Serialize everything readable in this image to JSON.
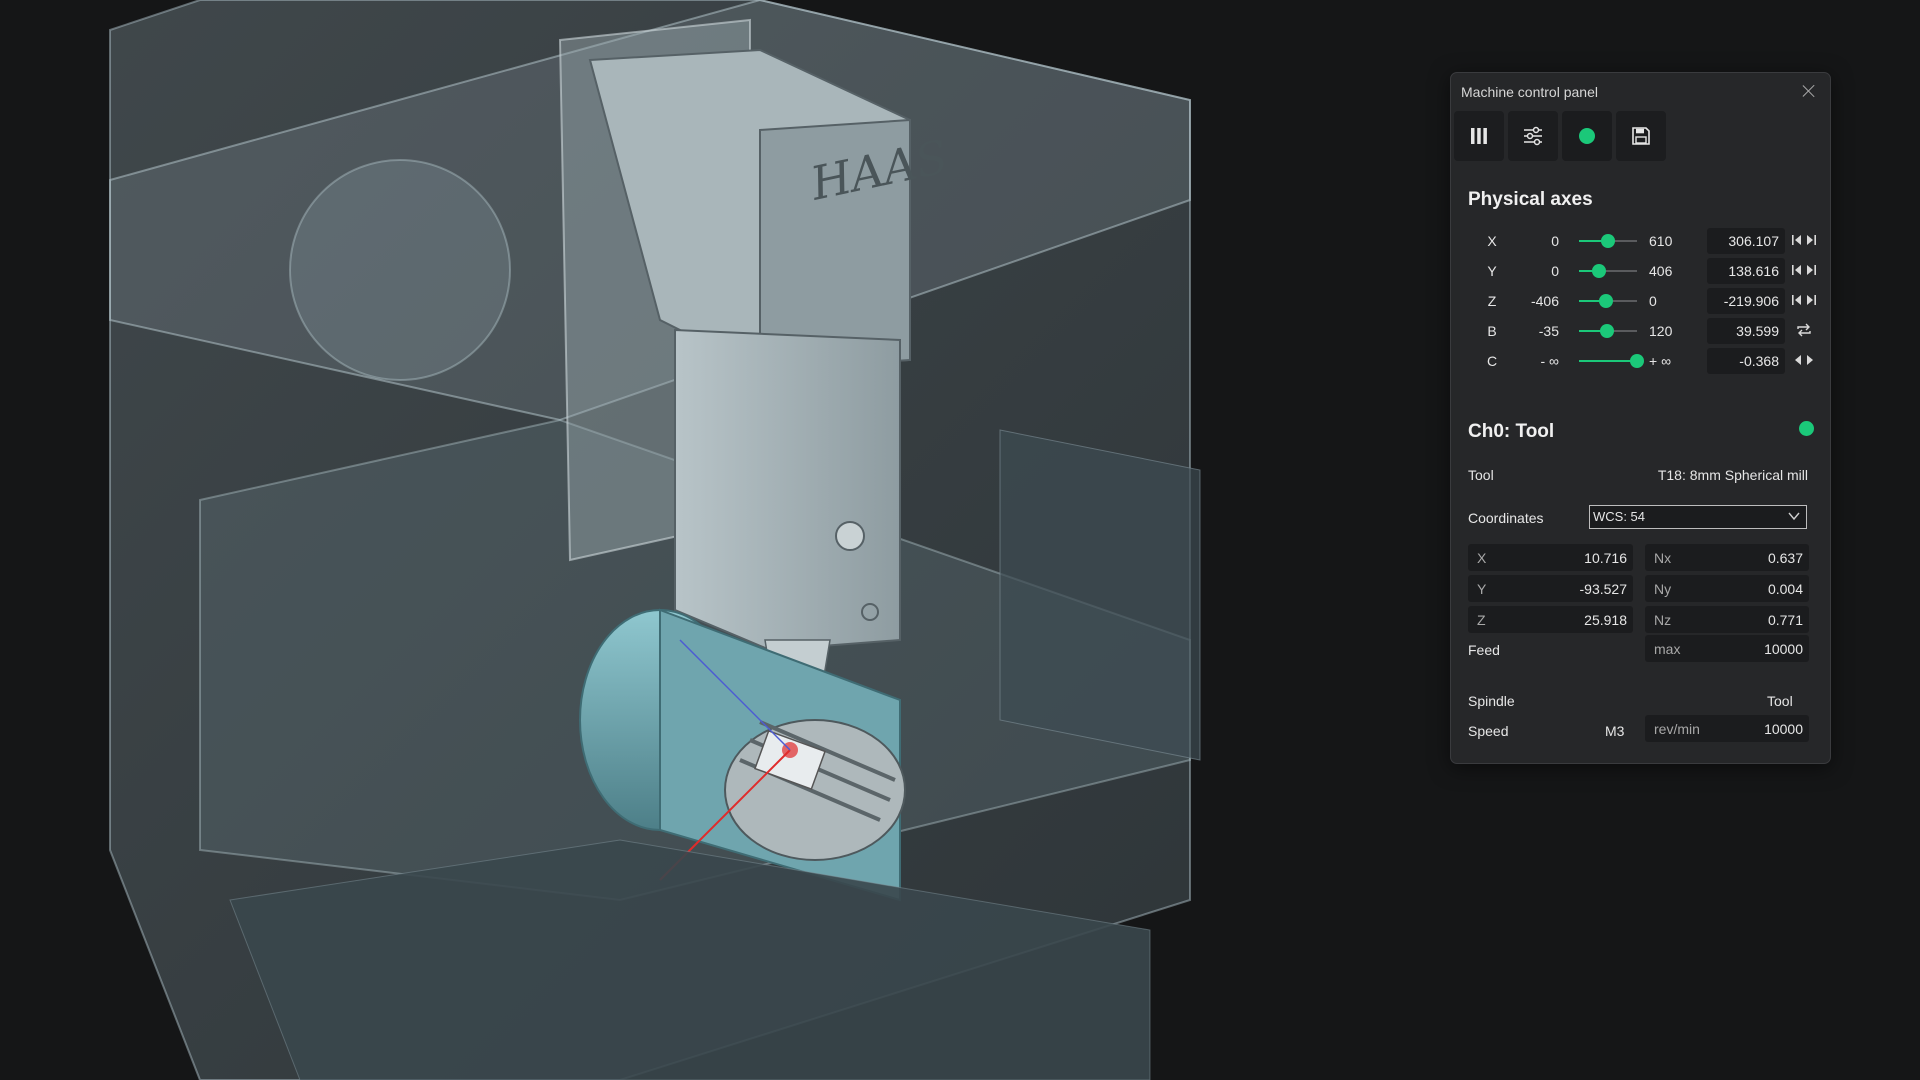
{
  "panel": {
    "title": "Machine control panel",
    "toolbar": [
      {
        "icon": "columns-icon"
      },
      {
        "icon": "sliders-icon"
      },
      {
        "icon": "status-dot-icon"
      },
      {
        "icon": "save-icon"
      }
    ],
    "physical_axes": {
      "title": "Physical axes",
      "axes": [
        {
          "name": "X",
          "min": "0",
          "max": "610",
          "value": "306.107",
          "position": 0.5,
          "control": "skip-icon"
        },
        {
          "name": "Y",
          "min": "0",
          "max": "406",
          "value": "138.616",
          "position": 0.34,
          "control": "skip-icon"
        },
        {
          "name": "Z",
          "min": "-406",
          "max": "0",
          "value": "-219.906",
          "position": 0.46,
          "control": "skip-icon"
        },
        {
          "name": "B",
          "min": "-35",
          "max": "120",
          "value": "39.599",
          "position": 0.49,
          "control": "loop-icon"
        },
        {
          "name": "C",
          "min": "- ∞",
          "max": "+ ∞",
          "value": "-0.368",
          "position": 1.0,
          "control": "step-icon"
        }
      ]
    },
    "channel": {
      "title": "Ch0: Tool",
      "tool_label": "Tool",
      "tool_value": "T18: 8mm Spherical mill",
      "coordinates_label": "Coordinates",
      "coordinates_value": "WCS: 54",
      "coords": [
        {
          "label": "X",
          "value": "10.716"
        },
        {
          "label": "Y",
          "value": "-93.527"
        },
        {
          "label": "Z",
          "value": "25.918"
        }
      ],
      "normals": [
        {
          "label": "Nx",
          "value": "0.637"
        },
        {
          "label": "Ny",
          "value": "0.004"
        },
        {
          "label": "Nz",
          "value": "0.771"
        }
      ],
      "feed_label": "Feed",
      "feed_unit": "max",
      "feed_value": "10000",
      "spindle_label": "Spindle",
      "spindle_source": "Tool",
      "speed_label": "Speed",
      "speed_mode": "M3",
      "speed_unit": "rev/min",
      "speed_value": "10000"
    }
  },
  "colors": {
    "accent": "#1bc879",
    "background": "#151617",
    "panel": "#262729"
  }
}
